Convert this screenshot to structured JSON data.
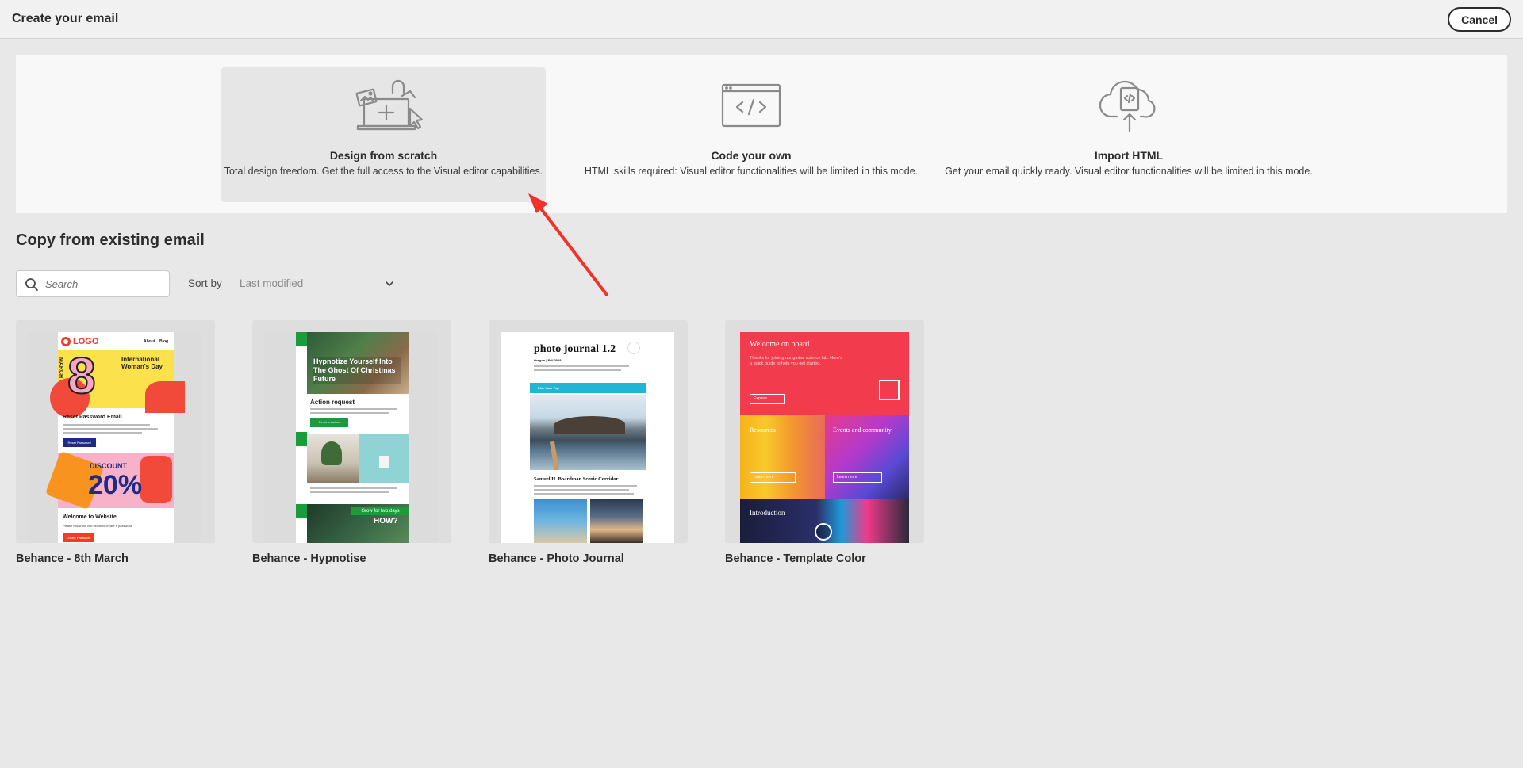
{
  "header": {
    "title": "Create your email",
    "cancel_label": "Cancel"
  },
  "options": [
    {
      "title": "Design from scratch",
      "description": "Total design freedom. Get the full access to the Visual editor capabilities.",
      "icon": "laptop-design-icon",
      "selected": true
    },
    {
      "title": "Code your own",
      "description": "HTML skills required: Visual editor functionalities will be limited in this mode.",
      "icon": "code-window-icon",
      "selected": false
    },
    {
      "title": "Import HTML",
      "description": "Get your email quickly ready. Visual editor functionalities will be limited in this mode.",
      "icon": "cloud-upload-icon",
      "selected": false
    }
  ],
  "copy_section": {
    "title": "Copy from existing email",
    "search": {
      "placeholder": "Search",
      "value": ""
    },
    "sort": {
      "label": "Sort by",
      "value": "Last modified"
    }
  },
  "templates": [
    {
      "name": "Behance - 8th March",
      "preview": {
        "logo": "LOGO",
        "nav": [
          "About",
          "Blog"
        ],
        "big_number": "8",
        "side_word": "MARCH",
        "headline": "International Woman's Day",
        "section1": "Reset Password Email",
        "button1": "Reset Password",
        "discount_label": "DISCOUNT",
        "discount_value": "20%",
        "section2": "Welcome to Website",
        "body2": "Please follow the link below to create a password",
        "button2": "Create Password"
      }
    },
    {
      "name": "Behance - Hypnotise",
      "preview": {
        "headline": "Hypnotize Yourself Into The Ghost Of Christmas Future",
        "section": "Action request",
        "button": "Perform Action",
        "promo_top": "Grow for two days",
        "promo_bottom": "HOW?"
      }
    },
    {
      "name": "Behance - Photo Journal",
      "preview": {
        "title": "photo journal 1.2",
        "subtitle": "Oregon | Fall 2018",
        "banner": "Plan Your Trip",
        "section": "Samuel H. Boardman Scenic Corridor"
      }
    },
    {
      "name": "Behance - Template Color",
      "preview": {
        "headline": "Welcome on board",
        "intro": "Thanks for joining our global science lab. Here's a quick guide to help you get started.",
        "button1": "Explore",
        "tile1": "Resources",
        "tile2": "Events and community",
        "button2": "Learn more",
        "button3": "Learn more",
        "tile3": "Introduction"
      }
    }
  ],
  "colors": {
    "annotation_arrow": "#f2312b",
    "accent_yellow": "#fbe14b",
    "accent_green": "#1a9b3c",
    "accent_red": "#f23b4d",
    "accent_cyan": "#1fb6d4"
  }
}
